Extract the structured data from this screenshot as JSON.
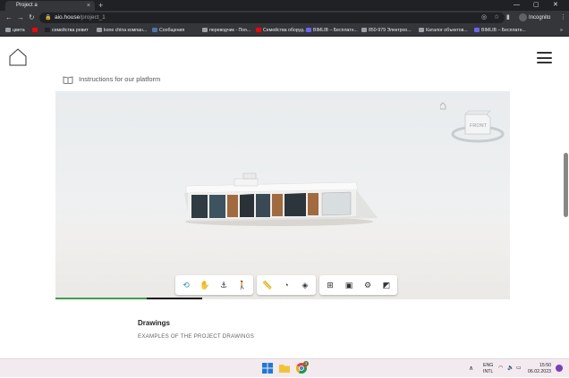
{
  "browser": {
    "tab_title": "Project a",
    "tab_close": "×",
    "new_tab": "+",
    "window_controls": [
      "—",
      "▢",
      "✕"
    ],
    "url_host": "aio.house",
    "url_path": "/project_1",
    "incognito_label": "Incognito",
    "bookmarks": [
      {
        "label": "цвета",
        "color": "#9aa0a6"
      },
      {
        "label": "",
        "color": "#ff0000"
      },
      {
        "label": "семейства ревит",
        "color": "#222222"
      },
      {
        "label": "kone china компан...",
        "color": "#9aa0a6"
      },
      {
        "label": "Сообщения",
        "color": "#4a76a8"
      },
      {
        "label": "переводчик - Поя...",
        "color": "#9aa0a6"
      },
      {
        "label": "Семейства оборуд...",
        "color": "#ff0000"
      },
      {
        "label": "BIMLIB – Бесплатн...",
        "color": "#6c63ff"
      },
      {
        "label": "850-979 Электроо...",
        "color": "#9aa0a6"
      },
      {
        "label": "Каталог объектов...",
        "color": "#9aa0a6"
      },
      {
        "label": "BIMLIB – Бесплатн...",
        "color": "#6c63ff"
      }
    ]
  },
  "page": {
    "instructions_label": "Instructions for our platform",
    "drawings_title": "Drawings",
    "drawings_subtitle": "EXAMPLES OF THE PROJECT DRAWINGS",
    "viewcube_label": "FRONT",
    "load_progress": 0.2
  },
  "toolbar": {
    "groups": [
      [
        "orbit-icon",
        "pan-icon",
        "first-person-icon",
        "walk-icon"
      ],
      [
        "measure-icon",
        "section-icon",
        "explode-icon"
      ],
      [
        "model-browser-icon",
        "properties-icon",
        "settings-icon",
        "fullscreen-icon"
      ]
    ]
  },
  "taskbar": {
    "language_line1": "ENG",
    "language_line2": "INTL",
    "time": "15:50",
    "date": "06.02.2023",
    "notification_count": "3"
  },
  "colors": {
    "accent_progress": "#3e9e4a",
    "browser_dark": "#202124"
  }
}
